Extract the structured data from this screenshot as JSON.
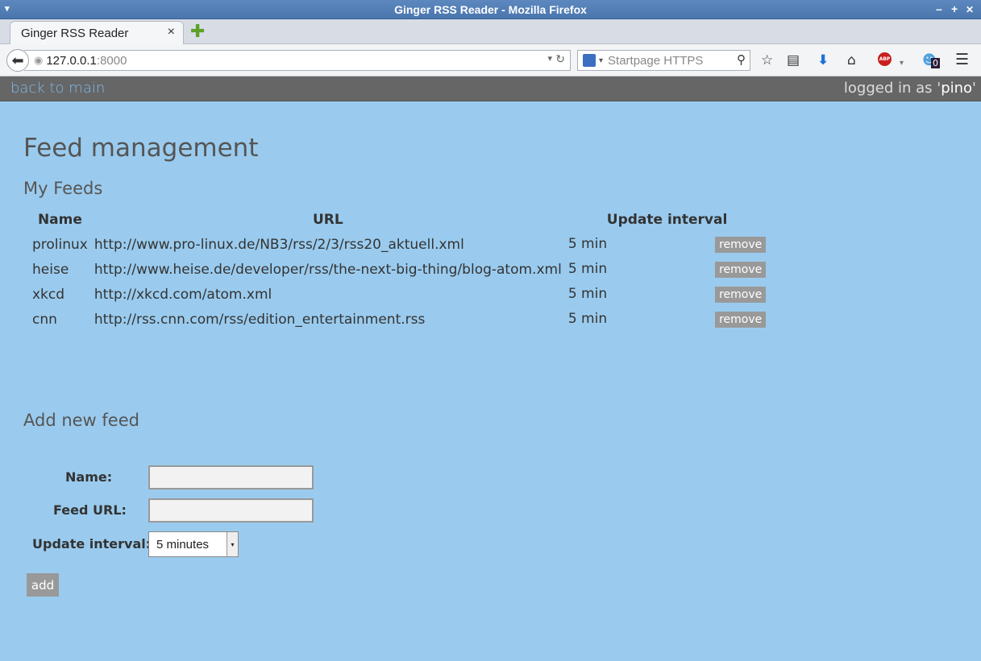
{
  "window": {
    "title": "Ginger RSS Reader - Mozilla Firefox",
    "menu_glyph": "▾",
    "minimize": "–",
    "maximize": "+",
    "close": "✕"
  },
  "tabs": [
    {
      "label": "Ginger RSS Reader",
      "close": "×"
    }
  ],
  "new_tab_glyph": "✚",
  "navbar": {
    "back_glyph": "⬅",
    "url_host": "127.0.0.1",
    "url_port": ":8000",
    "url_dropdown": "▾",
    "reload_glyph": "↻",
    "search_placeholder": "Startpage HTTPS",
    "search_dropdown": "▾",
    "search_glyph": "⚲",
    "icons": [
      "bookmark-star-icon",
      "reading-list-icon",
      "download-icon",
      "home-icon",
      "adblock-icon",
      "ghostery-icon",
      "menu-icon"
    ],
    "ghostery_count": "0",
    "adblock_label": "ABP"
  },
  "topbar": {
    "back_link": "back to main",
    "login_prefix": "logged in as '",
    "login_user": "pino",
    "login_suffix": "'"
  },
  "page": {
    "title": "Feed management",
    "my_feeds_heading": "My Feeds",
    "add_heading": "Add new feed"
  },
  "feeds_table": {
    "headers": {
      "name": "Name",
      "url": "URL",
      "interval": "Update interval"
    },
    "remove_label": "remove",
    "rows": [
      {
        "name": "prolinux",
        "url": "http://www.pro-linux.de/NB3/rss/2/3/rss20_aktuell.xml",
        "interval": "5 min"
      },
      {
        "name": "heise",
        "url": "http://www.heise.de/developer/rss/the-next-big-thing/blog-atom.xml",
        "interval": "5 min"
      },
      {
        "name": "xkcd",
        "url": "http://xkcd.com/atom.xml",
        "interval": "5 min"
      },
      {
        "name": "cnn",
        "url": "http://rss.cnn.com/rss/edition_entertainment.rss",
        "interval": "5 min"
      }
    ]
  },
  "form": {
    "name_label": "Name:",
    "name_value": "",
    "url_label": "Feed URL:",
    "url_value": "",
    "interval_label": "Update interval:",
    "interval_selected": "5 minutes",
    "interval_arrow": "▾",
    "add_label": "add"
  }
}
